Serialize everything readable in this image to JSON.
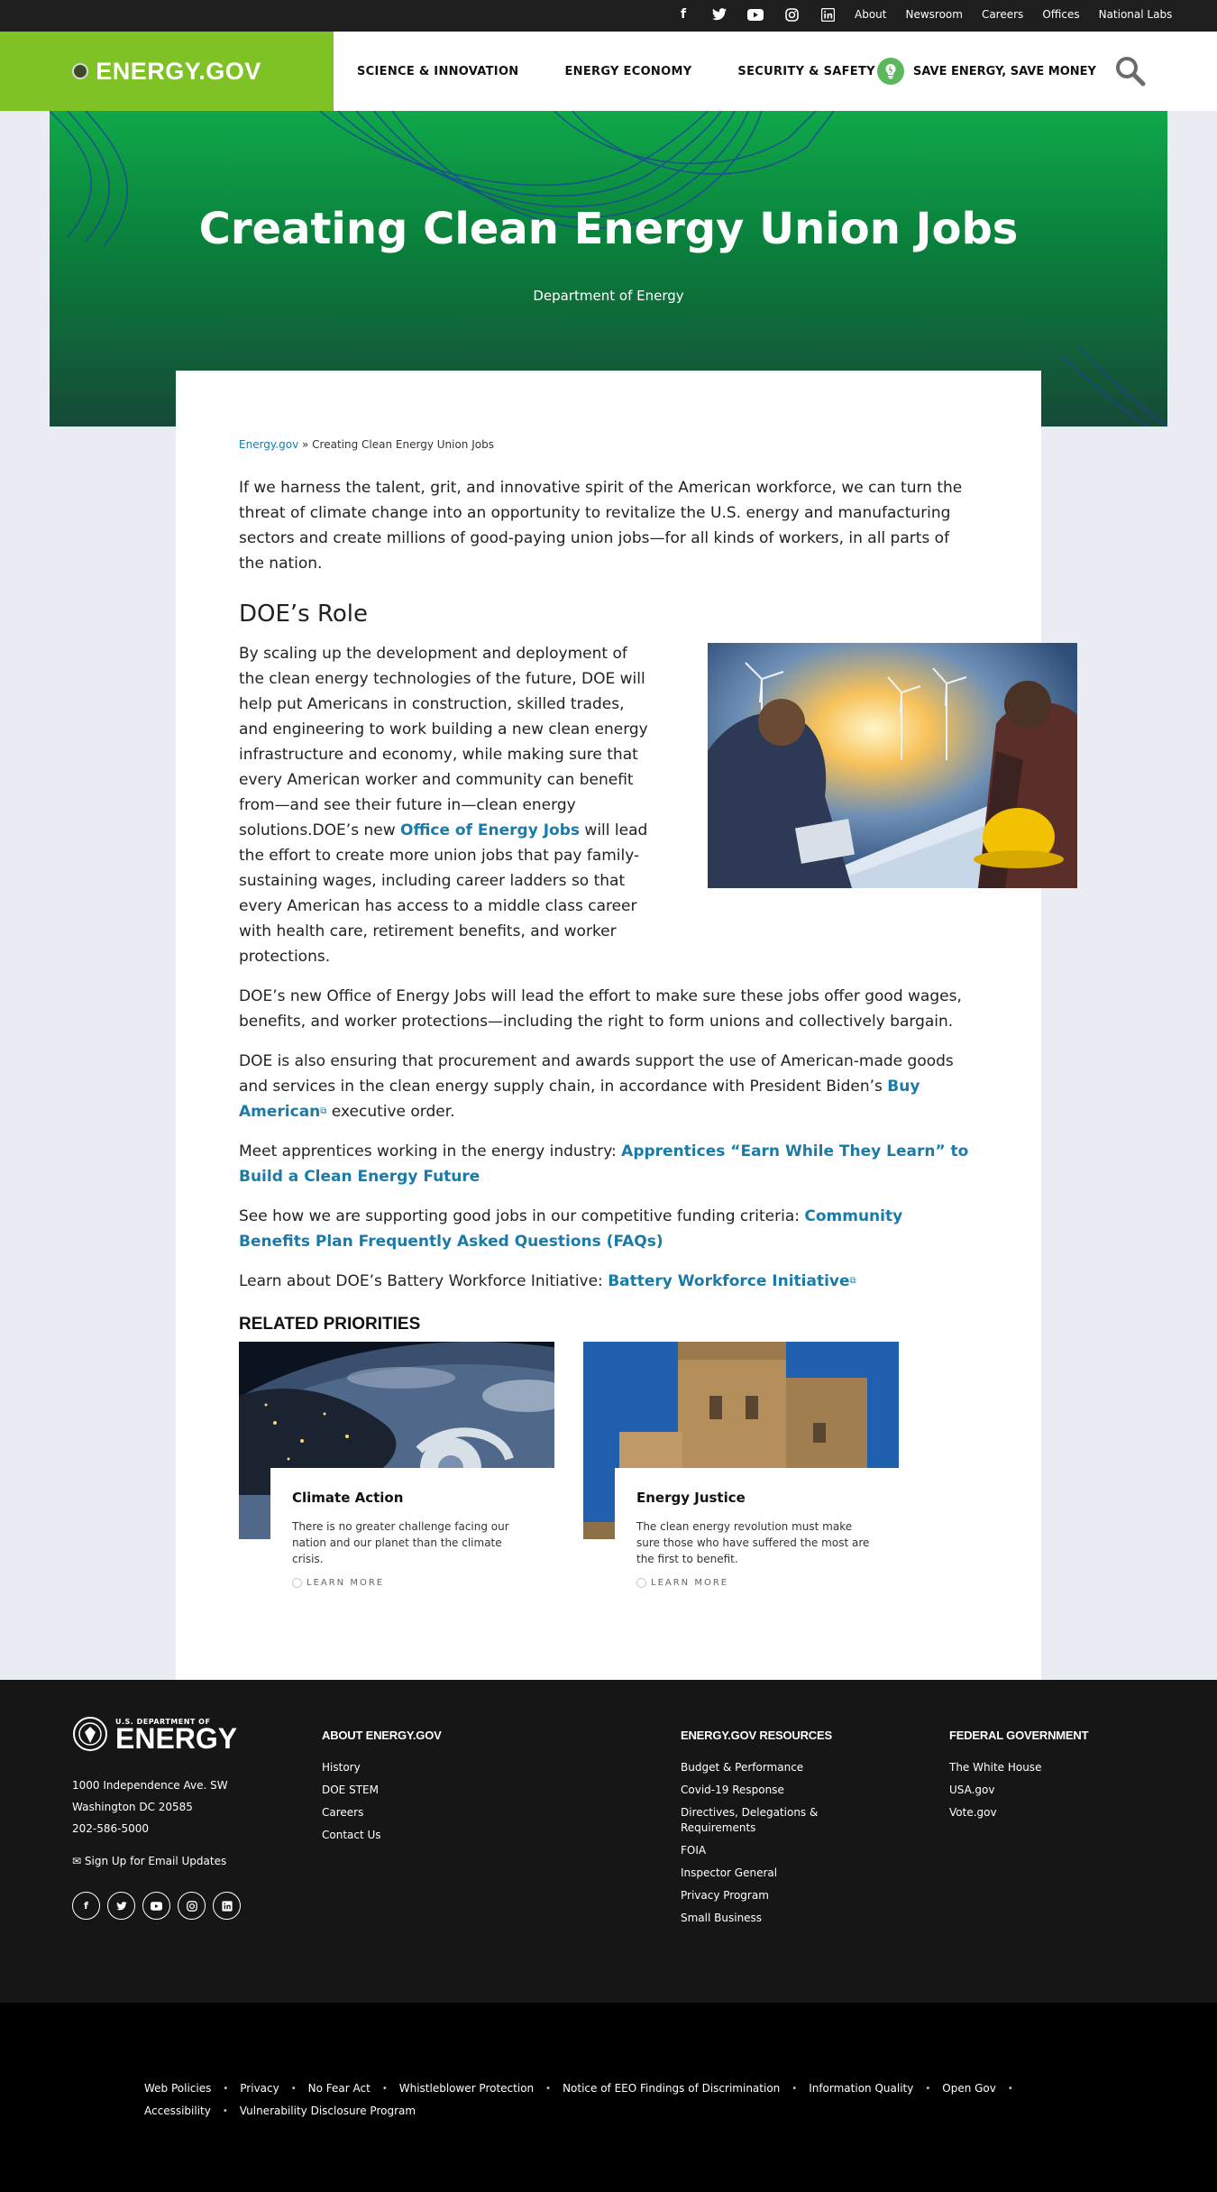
{
  "utility": {
    "social_icons": [
      "facebook-icon",
      "twitter-icon",
      "youtube-icon",
      "instagram-icon",
      "linkedin-icon"
    ],
    "links": [
      "About",
      "Newsroom",
      "Careers",
      "Offices",
      "National Labs"
    ]
  },
  "header": {
    "brand": "ENERGY.GOV",
    "nav": [
      "SCIENCE & INNOVATION",
      "ENERGY ECONOMY",
      "SECURITY & SAFETY"
    ],
    "save_label": "SAVE ENERGY, SAVE MONEY"
  },
  "hero": {
    "title": "Creating Clean Energy Union Jobs",
    "subtitle": "Department of Energy"
  },
  "breadcrumb": {
    "home": "Energy.gov",
    "sep": " » ",
    "current": "Creating Clean Energy Union Jobs"
  },
  "article": {
    "lead": "If we harness the talent, grit, and innovative spirit of the American workforce, we can turn the threat of climate change into an opportunity to revitalize the U.S. energy and manufacturing sectors and create millions of good-paying union jobs—for all kinds of workers, in all parts of the nation.",
    "role_heading": "DOE’s Role",
    "role_p1": "By scaling up the development and deployment of the clean energy technologies of the future, DOE will help put Americans in construction, skilled trades, and engineering to work building a new clean energy infrastructure and economy, while making sure that every American worker and community can benefit from—and see their future in—clean energy solutions.DOE’s new ",
    "role_link": "Office of Energy Jobs",
    "role_p2": " will lead the effort to create more union jobs that pay family-sustaining wages, including career ladders so that every American has access to a middle class career with health care, retirement benefits, and worker protections.",
    "p2": "DOE’s new Office of Energy Jobs will lead the effort to make sure these jobs offer good wages, benefits, and worker protections—including the right to form unions and collectively bargain.",
    "p3_a": "DOE is also ensuring that procurement and awards support the use of American-made goods and services in the clean energy supply chain, in accordance with President Biden’s ",
    "p3_link": "Buy American",
    "p3_b": " executive order.",
    "p4_a": "Meet apprentices working in the energy industry: ",
    "p4_link": "Apprentices “Earn While They Learn” to Build a Clean Energy Future",
    "p5_a": "See how we are supporting good jobs in our competitive funding criteria: ",
    "p5_link": "Community Benefits Plan Frequently Asked Questions (FAQs)",
    "p6_a": "Learn about DOE’s Battery Workforce Initiative: ",
    "p6_link": "Battery Workforce Initiative"
  },
  "related": {
    "title": "RELATED PRIORITIES",
    "tiles": [
      {
        "title": "Climate Action",
        "text": "There is no greater challenge facing our nation and our planet than the climate crisis.",
        "more": "LEARN MORE"
      },
      {
        "title": "Energy Justice",
        "text": "The clean energy revolution must make sure those who have suffered the most are the first to benefit.",
        "more": "LEARN MORE"
      }
    ]
  },
  "footer": {
    "logo_small": "U.S. DEPARTMENT OF",
    "logo_big": "ENERGY",
    "address": [
      "1000 Independence Ave. SW",
      "Washington DC 20585",
      "202-586-5000"
    ],
    "email": "Sign Up for Email Updates",
    "col1": {
      "title": "ABOUT ENERGY.GOV",
      "links": [
        "History",
        "DOE STEM",
        "Careers",
        "Contact Us"
      ]
    },
    "col2": {
      "title": "ENERGY.GOV RESOURCES",
      "links": [
        "Budget & Performance",
        "Covid-19 Response",
        "Directives, Delegations & Requirements",
        "FOIA",
        "Inspector General",
        "Privacy Program",
        "Small Business"
      ]
    },
    "col3": {
      "title": "FEDERAL GOVERNMENT",
      "links": [
        "The White House",
        "USA.gov",
        "Vote.gov"
      ]
    }
  },
  "bottom": {
    "row1": [
      "Web Policies",
      "Privacy",
      "No Fear Act",
      "Whistleblower Protection",
      "Notice of EEO Findings of Discrimination",
      "Information Quality",
      "Open Gov"
    ],
    "row2": [
      "Accessibility",
      "Vulnerability Disclosure Program"
    ]
  },
  "colors": {
    "brand_green": "#7ec225",
    "link_blue": "#1b7ba8",
    "hero_green": "#0a7d3b"
  }
}
